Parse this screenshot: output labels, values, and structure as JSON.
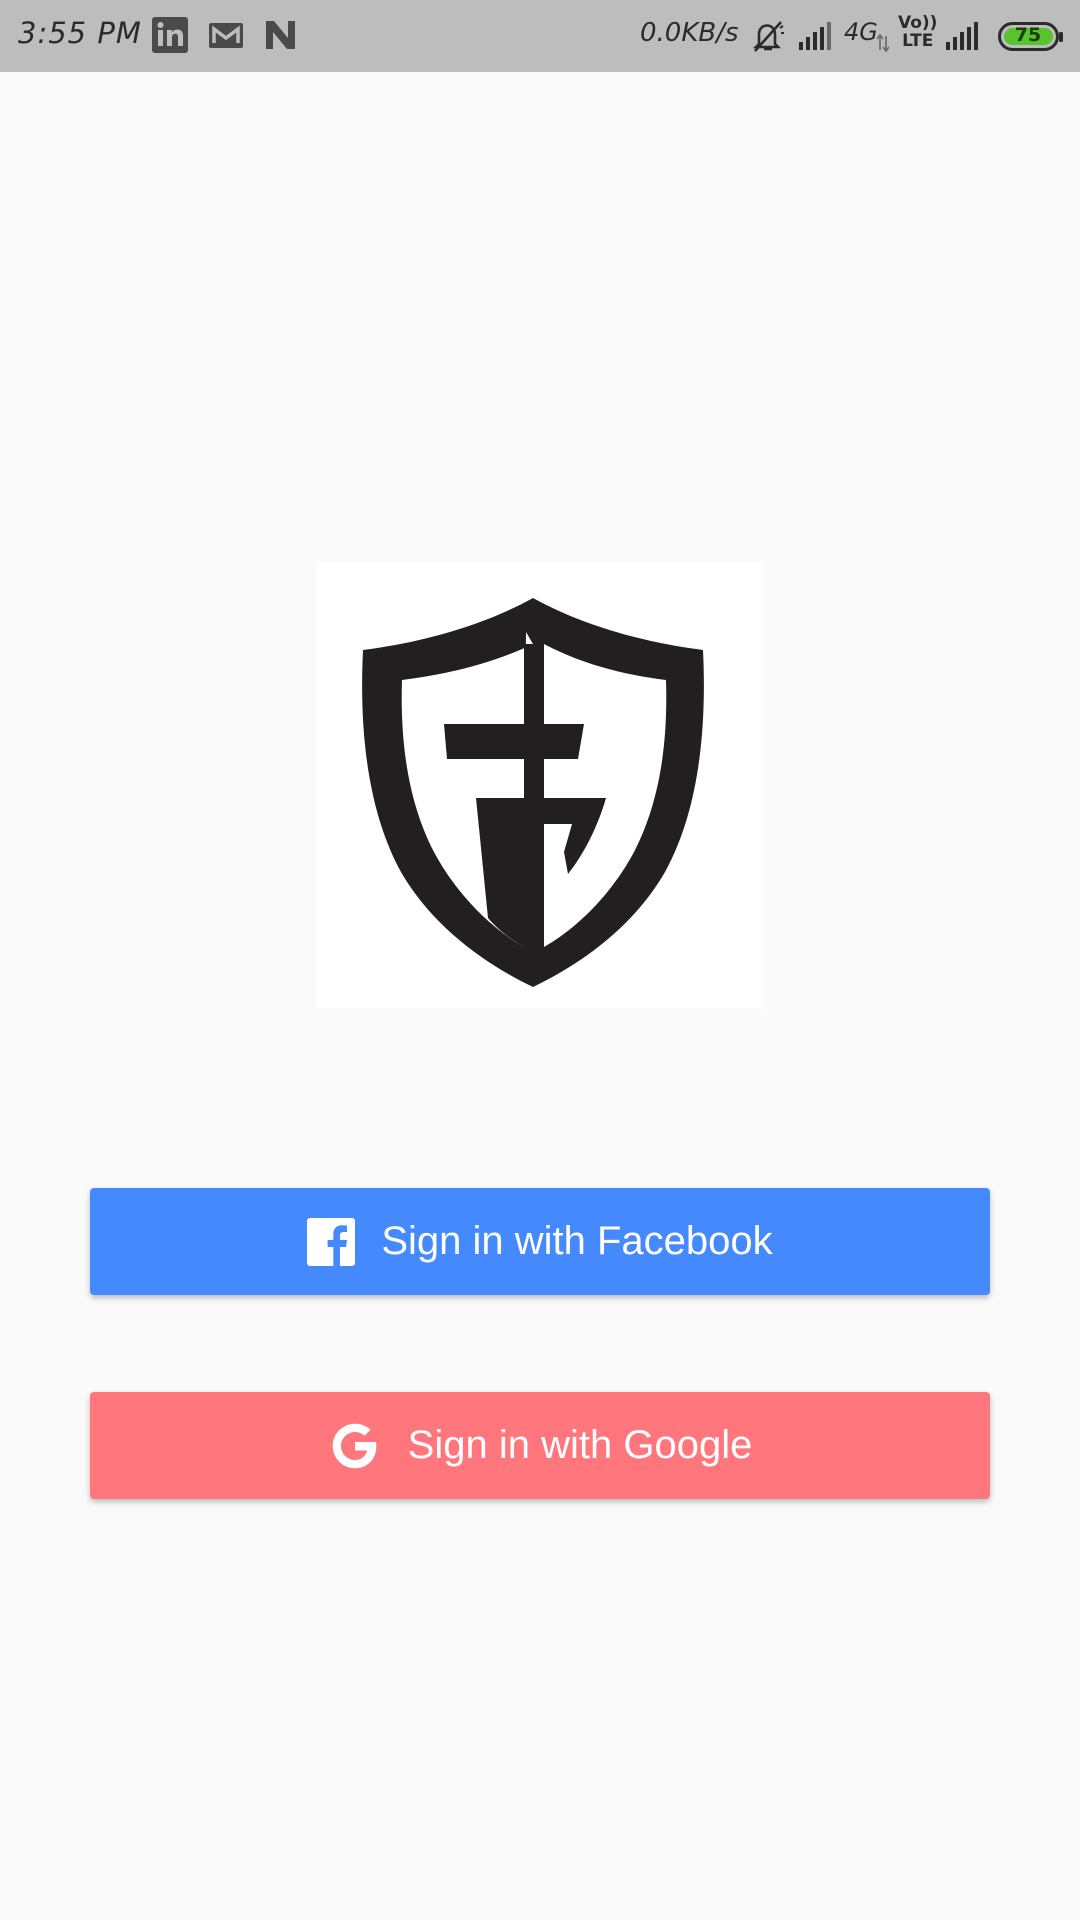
{
  "status_bar": {
    "time": "3:55 PM",
    "net_speed": "0.0KB/s",
    "network_type": "4G",
    "volte_top": "Vo))",
    "volte_bottom": "LTE",
    "battery_level": "75",
    "notification_icons": [
      "linkedin-icon",
      "gmail-icon",
      "n-app-icon"
    ]
  },
  "logo": {
    "letters": "FS"
  },
  "buttons": {
    "facebook_label": "Sign in with Facebook",
    "google_label": "Sign in with Google"
  },
  "colors": {
    "facebook_button": "#4589ff",
    "google_button": "#ff767c",
    "status_bar": "#bdbdbd",
    "battery_fill": "#56c42a"
  }
}
